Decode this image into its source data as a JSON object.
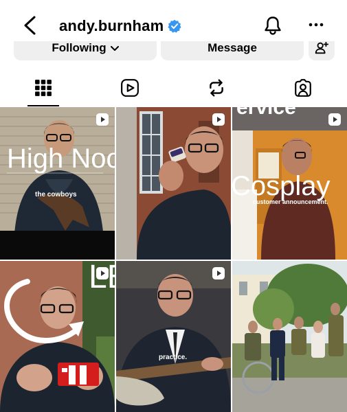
{
  "header": {
    "username": "andy.burnham",
    "verified": true
  },
  "actions": {
    "following_label": "Following",
    "message_label": "Message"
  },
  "tabs": [
    {
      "name": "grid",
      "icon": "grid-icon",
      "active": true
    },
    {
      "name": "reels",
      "icon": "reels-icon",
      "active": false
    },
    {
      "name": "reposts",
      "icon": "repost-icon",
      "active": false
    },
    {
      "name": "tagged",
      "icon": "tagged-icon",
      "active": false
    }
  ],
  "posts": [
    {
      "title": "High Noon",
      "caption": "the cowboys",
      "type": "reel"
    },
    {
      "title": "",
      "caption": "",
      "type": "reel"
    },
    {
      "title": "Cosplay",
      "caption": "customer announcement.",
      "sign_text": "ervice",
      "type": "reel"
    },
    {
      "title": "LEGO",
      "caption": "",
      "type": "reel"
    },
    {
      "title": "",
      "caption": "practice.",
      "type": "reel"
    },
    {
      "title": "",
      "caption": "",
      "type": "photo"
    }
  ],
  "colors": {
    "accent_verified": "#3797f0",
    "button_bg": "#efefef",
    "lego_red": "#d41e1e"
  }
}
